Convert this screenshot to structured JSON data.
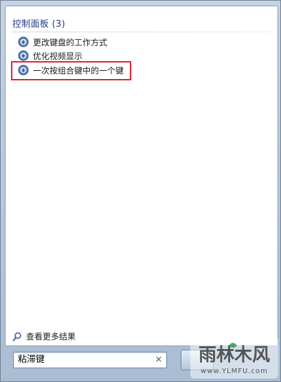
{
  "results": {
    "group_header": "控制面板 (3)",
    "items": [
      {
        "label": "更改键盘的工作方式",
        "icon": "control-panel-icon"
      },
      {
        "label": "优化视频显示",
        "icon": "control-panel-icon"
      },
      {
        "label": "一次按组合键中的一个键",
        "icon": "control-panel-icon"
      }
    ],
    "see_more": "查看更多结果"
  },
  "search": {
    "value": "粘滞键",
    "clear_glyph": "×"
  },
  "watermark": {
    "brand": "雨林木风",
    "url": "www.YLMFU.com"
  },
  "colors": {
    "header_text": "#1e3b8b",
    "highlight_border": "#e0232b",
    "pane_background": "#b9c8d8"
  }
}
